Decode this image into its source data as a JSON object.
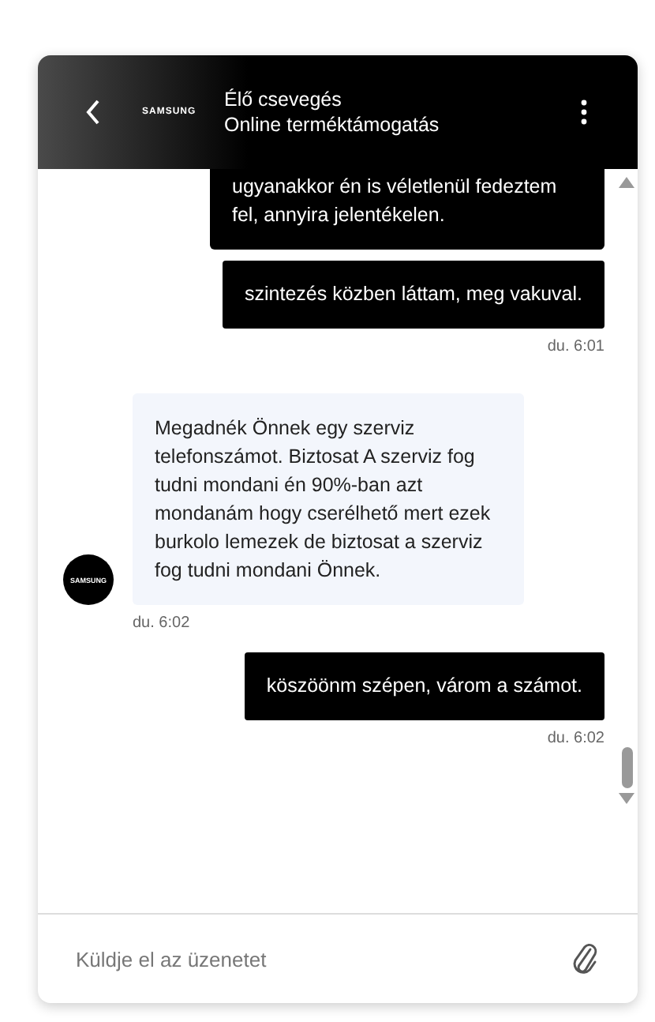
{
  "header": {
    "logo": "SAMSUNG",
    "title": "Élő csevegés",
    "subtitle": "Online terméktámogatás"
  },
  "messages": [
    {
      "kind": "user",
      "text": "ugyanakkor én is véletlenül fedeztem fel, annyira jelentékelen."
    },
    {
      "kind": "user",
      "text": "szintezés közben láttam, meg vakuval.",
      "time": "du. 6:01"
    },
    {
      "kind": "agent",
      "avatar": "SAMSUNG",
      "text": "Megadnék Önnek egy szerviz telefonszámot. Biztosat A szerviz fog tudni mondani én 90%-ban azt mondanám hogy cserélhető mert ezek burkolo lemezek de biztosat a szerviz fog tudni mondani Önnek.",
      "time": "du. 6:02"
    },
    {
      "kind": "user",
      "text": "köszöönm szépen, várom a számot.",
      "time": "du. 6:02"
    }
  ],
  "composer": {
    "placeholder": "Küldje el az üzenetet"
  }
}
